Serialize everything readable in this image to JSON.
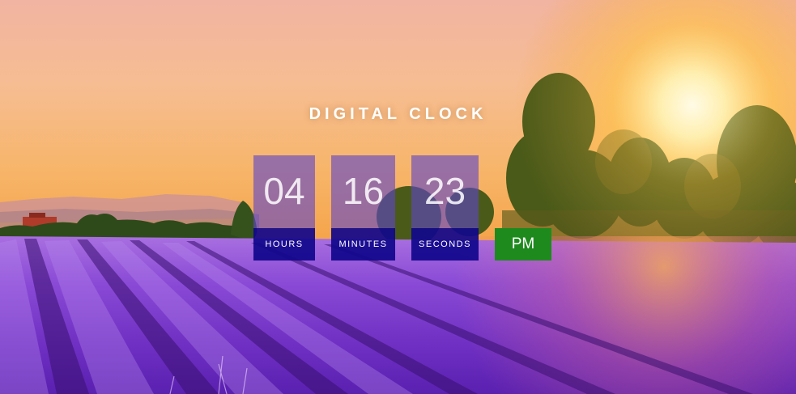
{
  "header": {
    "title": "DIGITAL CLOCK"
  },
  "clock": {
    "hours": {
      "value": "04",
      "label": "HOURS"
    },
    "minutes": {
      "value": "16",
      "label": "MINUTES"
    },
    "seconds": {
      "value": "23",
      "label": "SECONDS"
    },
    "period": "PM"
  },
  "colors": {
    "digit_box": "#6046c8",
    "label_box": "#10068c",
    "period_box": "#1e8a1e",
    "sky_top": "#f4b6a0",
    "sky_horizon": "#f6b35a",
    "field": "#7a3cc8"
  }
}
